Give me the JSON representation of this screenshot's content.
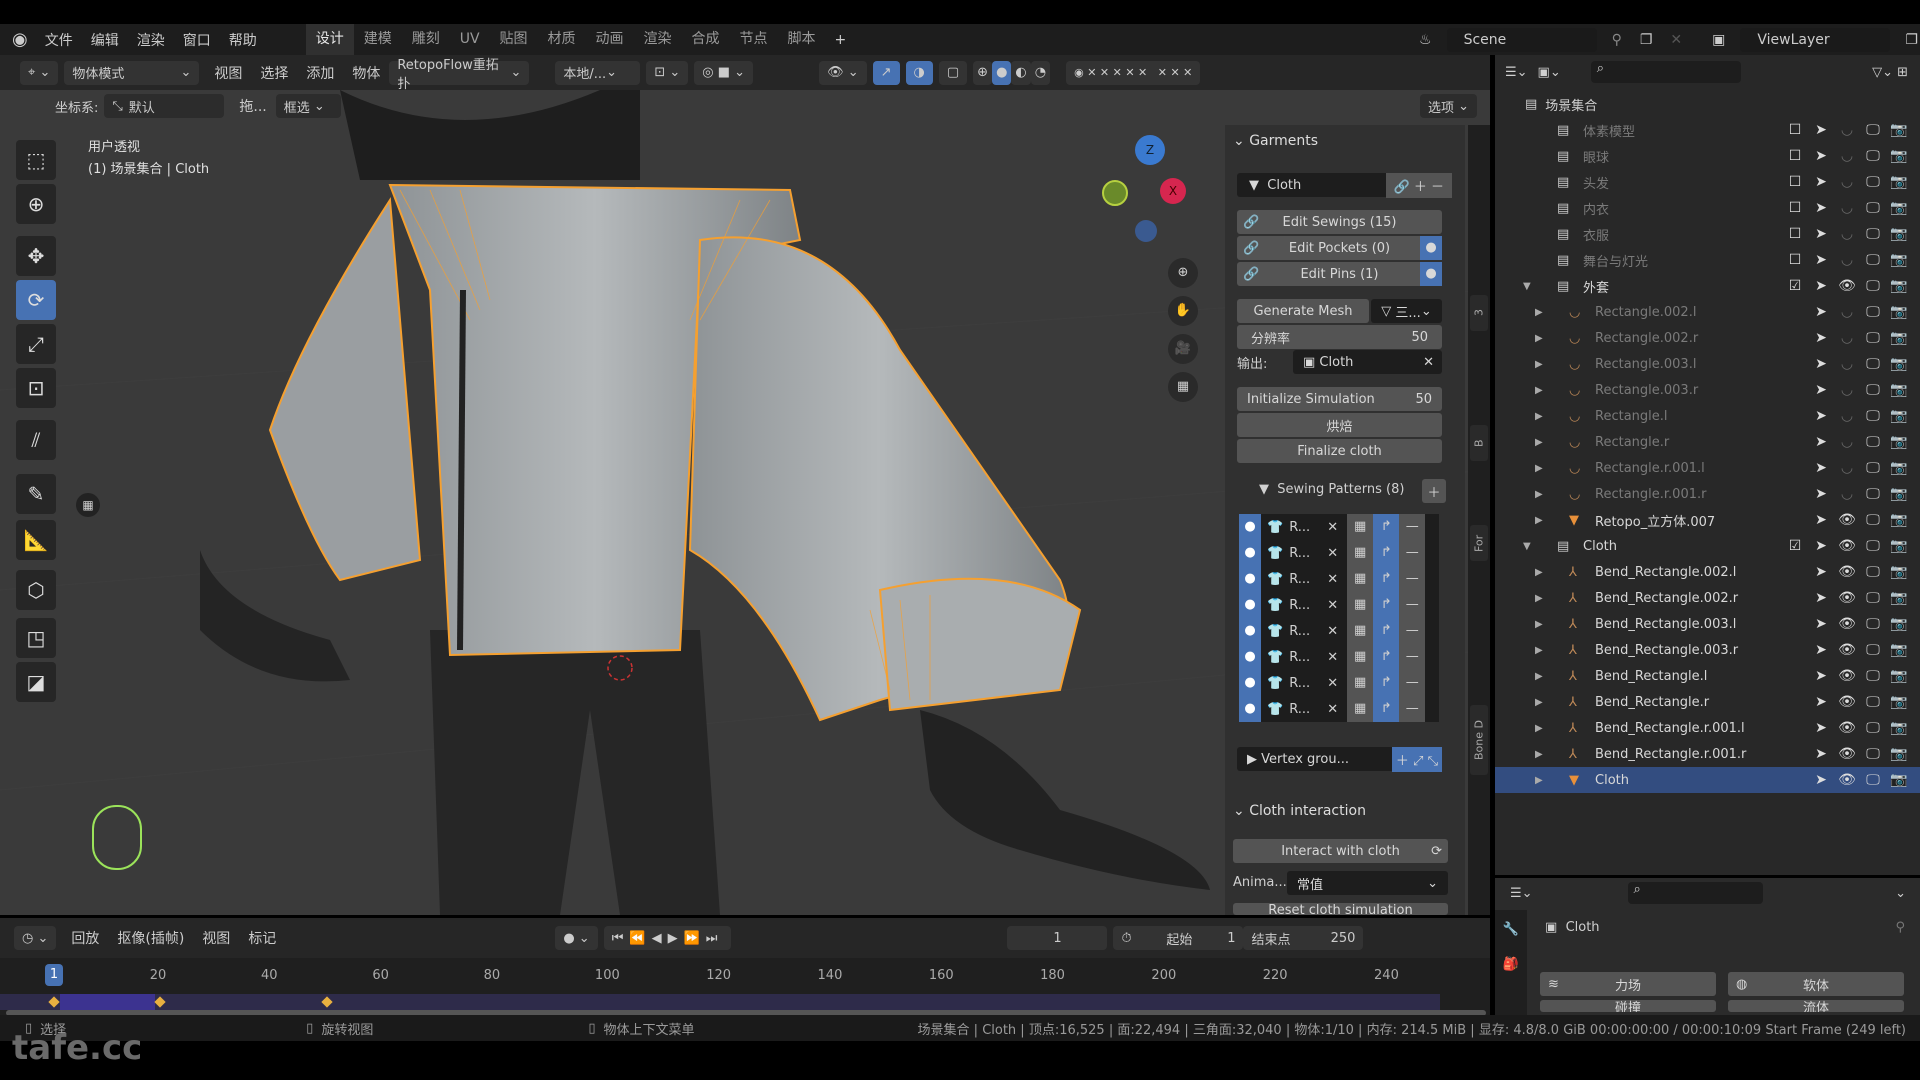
{
  "menu": {
    "items": [
      "文件",
      "编辑",
      "渲染",
      "窗口",
      "帮助"
    ],
    "workspaces": [
      "设计",
      "建模",
      "雕刻",
      "UV",
      "贴图",
      "材质",
      "动画",
      "渲染",
      "合成",
      "节点",
      "脚本"
    ],
    "active_workspace": "设计",
    "add": "+"
  },
  "scene": {
    "label": "Scene",
    "view_layer": "ViewLayer"
  },
  "header": {
    "mode": "物体模式",
    "items": [
      "视图",
      "选择",
      "添加",
      "物体"
    ],
    "addon": "RetopoFlow重拓扑",
    "pivot": "本地/...",
    "options": "选项"
  },
  "toolsettings": {
    "coord_label": "坐标系:",
    "coord_value": "默认",
    "drag": "拖...",
    "select": "框选"
  },
  "viewport": {
    "view_name": "用户透视",
    "context": "(1) 场景集合 | Cloth",
    "accent": "#f5a030"
  },
  "npanel": {
    "garments_title": "Garments",
    "cloth_name": "Cloth",
    "edit_sewings": "Edit Sewings (15)",
    "edit_pockets": "Edit Pockets (0)",
    "edit_pins": "Edit Pins (1)",
    "generate_mesh": "Generate Mesh",
    "gen_mode": "三...",
    "resolution_label": "分辨率",
    "resolution": "50",
    "output_label": "输出:",
    "output_value": "Cloth",
    "init_sim": "Initialize Simulation",
    "init_frames": "50",
    "bake": "烘焙",
    "finalize": "Finalize cloth",
    "sewing_patterns": "Sewing Patterns (8)",
    "patterns": [
      "R...",
      "R...",
      "R...",
      "R...",
      "R...",
      "R...",
      "R...",
      "R..."
    ],
    "vertex_groups": "Vertex grou...",
    "interaction_title": "Cloth interaction",
    "interact": "Interact with cloth",
    "anim_label": "Anima...",
    "anim_value": "常值",
    "reset": "Reset cloth simulation",
    "tabs": [
      "3",
      "B",
      "For",
      "Bone D"
    ]
  },
  "outliner": {
    "root": "场景集合",
    "rows": [
      {
        "name": "体素模型",
        "type": "collection",
        "indent": 1,
        "dim": true
      },
      {
        "name": "眼球",
        "type": "collection",
        "indent": 1,
        "dim": true
      },
      {
        "name": "头发",
        "type": "collection",
        "indent": 1,
        "dim": true
      },
      {
        "name": "内衣",
        "type": "collection",
        "indent": 1,
        "dim": true
      },
      {
        "name": "衣服",
        "type": "collection",
        "indent": 1,
        "dim": true
      },
      {
        "name": "舞台与灯光",
        "type": "collection",
        "indent": 1,
        "dim": true
      },
      {
        "name": "外套",
        "type": "collection",
        "indent": 1,
        "expanded": true,
        "checked": true
      },
      {
        "name": "Rectangle.002.l",
        "type": "curve",
        "indent": 2,
        "dim": true
      },
      {
        "name": "Rectangle.002.r",
        "type": "curve",
        "indent": 2,
        "dim": true
      },
      {
        "name": "Rectangle.003.l",
        "type": "curve",
        "indent": 2,
        "dim": true
      },
      {
        "name": "Rectangle.003.r",
        "type": "curve",
        "indent": 2,
        "dim": true
      },
      {
        "name": "Rectangle.l",
        "type": "curve",
        "indent": 2,
        "dim": true
      },
      {
        "name": "Rectangle.r",
        "type": "curve",
        "indent": 2,
        "dim": true
      },
      {
        "name": "Rectangle.r.001.l",
        "type": "curve",
        "indent": 2,
        "dim": true
      },
      {
        "name": "Rectangle.r.001.r",
        "type": "curve",
        "indent": 2,
        "dim": true
      },
      {
        "name": "Retopo_立方体.007",
        "type": "mesh",
        "indent": 2
      },
      {
        "name": "Cloth",
        "type": "collection",
        "indent": 1,
        "expanded": true,
        "checked": true
      },
      {
        "name": "Bend_Rectangle.002.l",
        "type": "armature",
        "indent": 2
      },
      {
        "name": "Bend_Rectangle.002.r",
        "type": "armature",
        "indent": 2
      },
      {
        "name": "Bend_Rectangle.003.l",
        "type": "armature",
        "indent": 2
      },
      {
        "name": "Bend_Rectangle.003.r",
        "type": "armature",
        "indent": 2
      },
      {
        "name": "Bend_Rectangle.l",
        "type": "armature",
        "indent": 2
      },
      {
        "name": "Bend_Rectangle.r",
        "type": "armature",
        "indent": 2
      },
      {
        "name": "Bend_Rectangle.r.001.l",
        "type": "armature",
        "indent": 2
      },
      {
        "name": "Bend_Rectangle.r.001.r",
        "type": "armature",
        "indent": 2
      },
      {
        "name": "Cloth",
        "type": "mesh",
        "indent": 2,
        "selected": true
      }
    ]
  },
  "properties": {
    "object": "Cloth",
    "buttons": [
      "力场",
      "软体",
      "碰撞",
      "流体"
    ]
  },
  "timeline": {
    "menus": [
      "回放",
      "抠像(插帧)",
      "视图",
      "标记"
    ],
    "current_frame": "1",
    "start_label": "起始",
    "start": "1",
    "end_label": "结束点",
    "end": "250",
    "ticks": [
      "20",
      "40",
      "60",
      "80",
      "100",
      "120",
      "140",
      "160",
      "180",
      "200",
      "220",
      "240"
    ],
    "keyframes": [
      1,
      20,
      50
    ]
  },
  "status": {
    "left": "选择",
    "middle": "旋转视图",
    "right": "物体上下文菜单",
    "stats": "场景集合 | Cloth | 顶点:16,525 | 面:22,494 | 三角面:32,040 | 物体:1/10 | 内存: 214.5 MiB | 显存: 4.8/8.0 GiB   00:00:00:00 / 00:00:10:09  Start Frame (249 left)"
  },
  "watermark": "tafe.cc",
  "colors": {
    "selected": "#4772b3",
    "accent": "#f5a030",
    "bg": "#303030"
  }
}
